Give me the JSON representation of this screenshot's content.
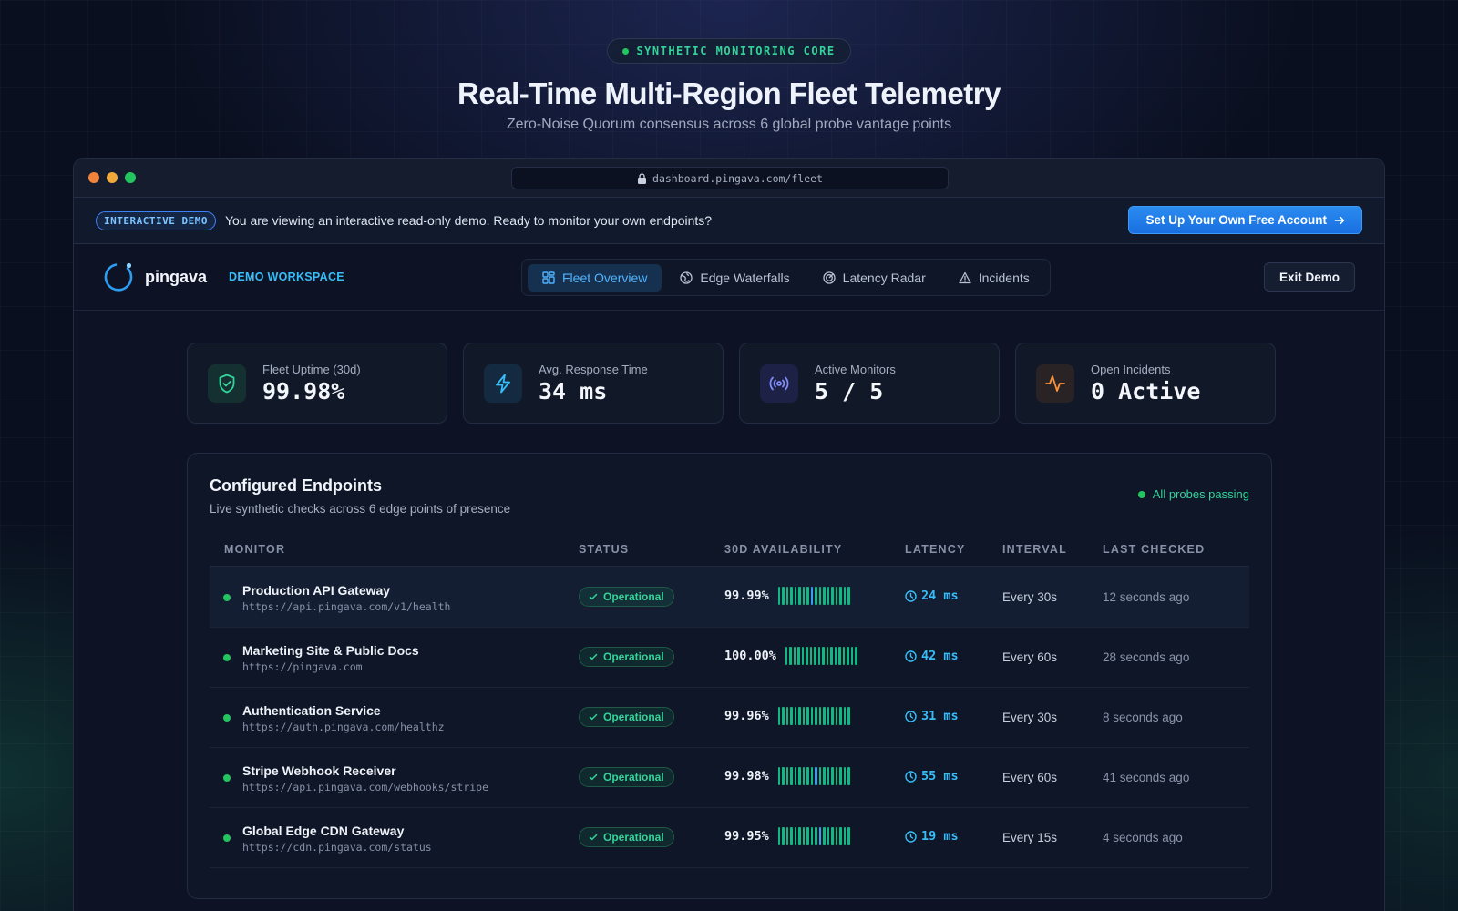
{
  "hero": {
    "pill": "SYNTHETIC MONITORING CORE",
    "title": "Real-Time Multi-Region Fleet Telemetry",
    "subtitle": "Zero-Noise Quorum consensus across 6 global probe vantage points"
  },
  "browser": {
    "url": "dashboard.pingava.com/fleet"
  },
  "banner": {
    "tag": "INTERACTIVE DEMO",
    "text": "You are viewing an interactive read-only demo. Ready to monitor your own endpoints?",
    "cta": "Set Up Your Own Free Account"
  },
  "nav": {
    "brand": "pingava",
    "workspace": "DEMO WORKSPACE",
    "tabs": [
      {
        "label": "Fleet Overview",
        "icon": "grid-icon",
        "active": true
      },
      {
        "label": "Edge Waterfalls",
        "icon": "globe-icon",
        "active": false
      },
      {
        "label": "Latency Radar",
        "icon": "radar-icon",
        "active": false
      },
      {
        "label": "Incidents",
        "icon": "warning-icon",
        "active": false
      }
    ],
    "exit": "Exit Demo"
  },
  "stats": [
    {
      "label": "Fleet Uptime (30d)",
      "value": "99.98%",
      "icon": "shield-check-icon",
      "color": "#34d399"
    },
    {
      "label": "Avg. Response Time",
      "value": "34 ms",
      "icon": "lightning-icon",
      "color": "#38bdf8"
    },
    {
      "label": "Active Monitors",
      "value": "5 / 5",
      "icon": "broadcast-icon",
      "color": "#818cf8"
    },
    {
      "label": "Open Incidents",
      "value": "0 Active",
      "icon": "pulse-icon",
      "color": "#fb923c"
    }
  ],
  "panel": {
    "title": "Configured Endpoints",
    "subtitle": "Live synthetic checks across 6 edge points of presence",
    "status": "All probes passing",
    "columns": [
      "MONITOR",
      "STATUS",
      "30D AVAILABILITY",
      "LATENCY",
      "INTERVAL",
      "LAST CHECKED"
    ],
    "rows": [
      {
        "name": "Production API Gateway",
        "url": "https://api.pingava.com/v1/health",
        "status": "Operational",
        "availability": "99.99%",
        "latency": "24 ms",
        "interval": "Every 30s",
        "checked": "12 seconds ago"
      },
      {
        "name": "Marketing Site & Public Docs",
        "url": "https://pingava.com",
        "status": "Operational",
        "availability": "100.00%",
        "latency": "42 ms",
        "interval": "Every 60s",
        "checked": "28 seconds ago"
      },
      {
        "name": "Authentication Service",
        "url": "https://auth.pingava.com/healthz",
        "status": "Operational",
        "availability": "99.96%",
        "latency": "31 ms",
        "interval": "Every 30s",
        "checked": "8 seconds ago"
      },
      {
        "name": "Stripe Webhook Receiver",
        "url": "https://api.pingava.com/webhooks/stripe",
        "status": "Operational",
        "availability": "99.98%",
        "latency": "55 ms",
        "interval": "Every 60s",
        "checked": "41 seconds ago"
      },
      {
        "name": "Global Edge CDN Gateway",
        "url": "https://cdn.pingava.com/status",
        "status": "Operational",
        "availability": "99.95%",
        "latency": "19 ms",
        "interval": "Every 15s",
        "checked": "4 seconds ago"
      }
    ]
  }
}
